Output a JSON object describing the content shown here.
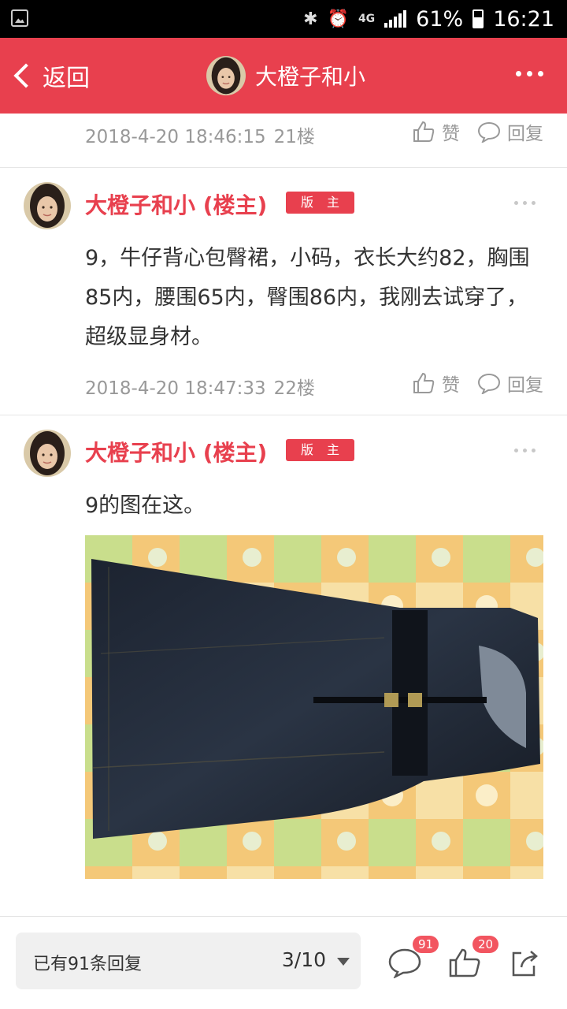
{
  "status_bar": {
    "battery": "61%",
    "time": "16:21",
    "network": "4G"
  },
  "header": {
    "back_label": "返回",
    "title": "大橙子和小"
  },
  "posts": [
    {
      "timestamp": "2018-4-20 18:46:15",
      "floor": "21楼",
      "like_label": "赞",
      "reply_label": "回复"
    },
    {
      "author": "大橙子和小 (楼主)",
      "badge": "版 主",
      "text": "9，牛仔背心包臀裙，小码，衣长大约82，胸围85内，腰围65内，臀围86内，我刚去试穿了，超级显身材。",
      "timestamp": "2018-4-20 18:47:33",
      "floor": "22楼",
      "like_label": "赞",
      "reply_label": "回复"
    },
    {
      "author": "大橙子和小 (楼主)",
      "badge": "版 主",
      "text": "9的图在这。",
      "image_alt": "denim-dress-photo"
    }
  ],
  "bottom_bar": {
    "reply_count_text": "已有91条回复",
    "page": "3/10",
    "comment_count": "91",
    "like_count": "20"
  },
  "colors": {
    "accent": "#e8404e",
    "meta_text": "#999999"
  }
}
